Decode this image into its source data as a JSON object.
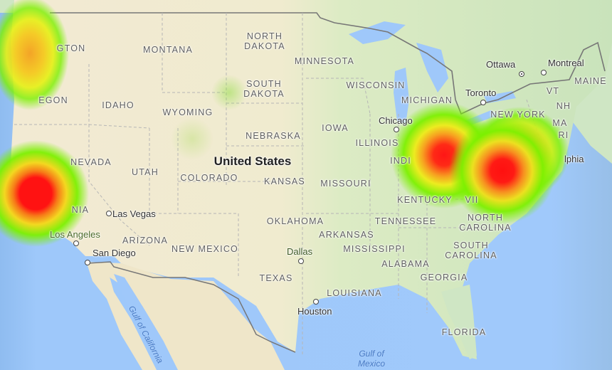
{
  "map": {
    "title": "United States",
    "country_label": "United States",
    "states": [
      {
        "id": "washington",
        "label": "WASHINGTON",
        "visible_label": "GTON"
      },
      {
        "id": "oregon",
        "label": "OREGON",
        "visible_label": "EGON"
      },
      {
        "id": "california",
        "label": "CALIFORNIA",
        "visible_label": "NIA"
      },
      {
        "id": "nevada",
        "label": "NEVADA"
      },
      {
        "id": "idaho",
        "label": "IDAHO"
      },
      {
        "id": "montana",
        "label": "MONTANA"
      },
      {
        "id": "wyoming",
        "label": "WYOMING"
      },
      {
        "id": "utah",
        "label": "UTAH"
      },
      {
        "id": "arizona",
        "label": "ARIZONA"
      },
      {
        "id": "colorado",
        "label": "COLORADO"
      },
      {
        "id": "new-mexico",
        "label": "NEW MEXICO"
      },
      {
        "id": "north-dakota",
        "label": "NORTH\nDAKOTA"
      },
      {
        "id": "south-dakota",
        "label": "SOUTH\nDAKOTA"
      },
      {
        "id": "nebraska",
        "label": "NEBRASKA"
      },
      {
        "id": "kansas",
        "label": "KANSAS"
      },
      {
        "id": "oklahoma",
        "label": "OKLAHOMA"
      },
      {
        "id": "texas",
        "label": "TEXAS"
      },
      {
        "id": "minnesota",
        "label": "MINNESOTA"
      },
      {
        "id": "iowa",
        "label": "IOWA"
      },
      {
        "id": "missouri",
        "label": "MISSOURI"
      },
      {
        "id": "arkansas",
        "label": "ARKANSAS"
      },
      {
        "id": "louisiana",
        "label": "LOUISIANA"
      },
      {
        "id": "wisconsin",
        "label": "WISCONSIN"
      },
      {
        "id": "illinois",
        "label": "ILLINOIS"
      },
      {
        "id": "michigan",
        "label": "MICHIGAN"
      },
      {
        "id": "indiana",
        "label": "INDIANA",
        "visible_label": "INDI"
      },
      {
        "id": "kentucky",
        "label": "KENTUCKY"
      },
      {
        "id": "tennessee",
        "label": "TENNESSEE"
      },
      {
        "id": "mississippi",
        "label": "MISSISSIPPI"
      },
      {
        "id": "alabama",
        "label": "ALABAMA"
      },
      {
        "id": "georgia",
        "label": "GEORGIA"
      },
      {
        "id": "florida",
        "label": "FLORIDA"
      },
      {
        "id": "south-carolina",
        "label": "SOUTH\nCAROLINA"
      },
      {
        "id": "north-carolina",
        "label": "NORTH\nCAROLINA"
      },
      {
        "id": "virginia",
        "label": "VIRGINIA",
        "visible_label": "VII"
      },
      {
        "id": "new-york",
        "label": "NEW YORK"
      },
      {
        "id": "vermont",
        "label": "VT"
      },
      {
        "id": "new-hampshire",
        "label": "NH"
      },
      {
        "id": "massachusetts",
        "label": "MA"
      },
      {
        "id": "rhode-island",
        "label": "RI"
      },
      {
        "id": "maine",
        "label": "MAINE"
      }
    ],
    "cities": [
      {
        "id": "las-vegas",
        "label": "Las Vegas"
      },
      {
        "id": "los-angeles",
        "label": "Los Angeles"
      },
      {
        "id": "san-diego",
        "label": "San Diego"
      },
      {
        "id": "dallas",
        "label": "Dallas"
      },
      {
        "id": "houston",
        "label": "Houston"
      },
      {
        "id": "chicago",
        "label": "Chicago"
      },
      {
        "id": "toronto",
        "label": "Toronto"
      },
      {
        "id": "ottawa",
        "label": "Ottawa",
        "capital": true
      },
      {
        "id": "montreal",
        "label": "Montreal"
      },
      {
        "id": "philadelphia",
        "label": "Philadelphia",
        "visible_label": "lphia"
      }
    ],
    "water_labels": [
      {
        "id": "gulf-of-california",
        "label": "Gulf of California"
      },
      {
        "id": "gulf-of-mexico",
        "label": "Gulf of\nMexico"
      }
    ],
    "heatmap": {
      "colors": {
        "low": "#7cf000",
        "mid": "#f5e400",
        "high": "#ff1a1a"
      },
      "hotspots": [
        {
          "id": "pacific-northwest",
          "region": "Washington / Oregon coast",
          "intensity": 0.65
        },
        {
          "id": "northern-california",
          "region": "Northern California (San Francisco area)",
          "intensity": 1.0
        },
        {
          "id": "ohio",
          "region": "Ohio / Indiana",
          "intensity": 0.95
        },
        {
          "id": "mid-atlantic",
          "region": "West Virginia / Virginia / Maryland",
          "intensity": 1.0
        },
        {
          "id": "northeast",
          "region": "Pennsylvania / New Jersey",
          "intensity": 0.6
        },
        {
          "id": "south-dakota",
          "region": "Western South Dakota",
          "intensity": 0.1
        }
      ]
    }
  }
}
